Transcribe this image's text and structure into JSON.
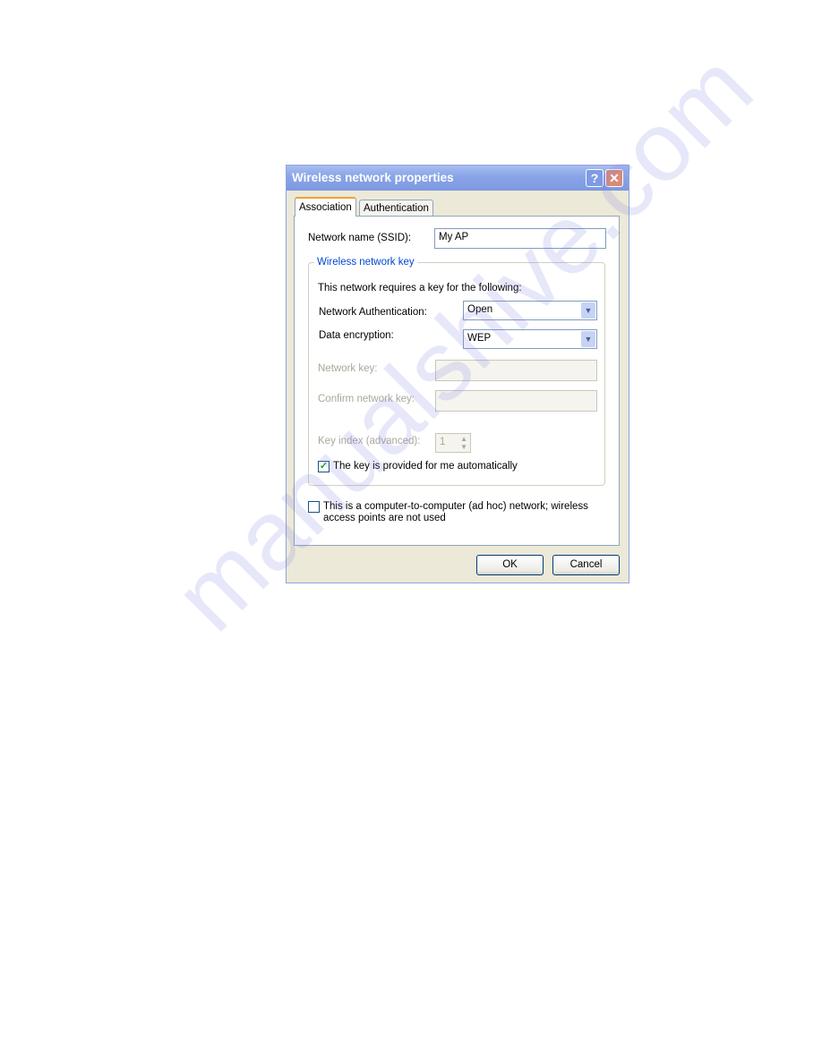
{
  "dialog": {
    "title": "Wireless network properties",
    "help_icon": "?",
    "close_icon": "✕",
    "tabs": [
      {
        "label": "Association",
        "active": true
      },
      {
        "label": "Authentication",
        "active": false
      }
    ],
    "ssid_label": "Network name (SSID):",
    "ssid_value": "My AP",
    "group_label": "Wireless network key",
    "requires_text": "This network requires a key for the following:",
    "auth_label": "Network Authentication:",
    "auth_value": "Open",
    "enc_label": "Data encryption:",
    "enc_value": "WEP",
    "key_label": "Network key:",
    "key_value": "",
    "confirm_label": "Confirm network key:",
    "confirm_value": "",
    "index_label": "Key index (advanced):",
    "index_value": "1",
    "auto_key_label": "The key is provided for me automatically",
    "auto_key_checked": true,
    "adhoc_label_1": "This is a computer-to-computer (ad hoc) network; wireless",
    "adhoc_label_2": "access points are not used",
    "adhoc_checked": false,
    "ok_label": "OK",
    "cancel_label": "Cancel"
  },
  "watermark": "manualshive.com"
}
